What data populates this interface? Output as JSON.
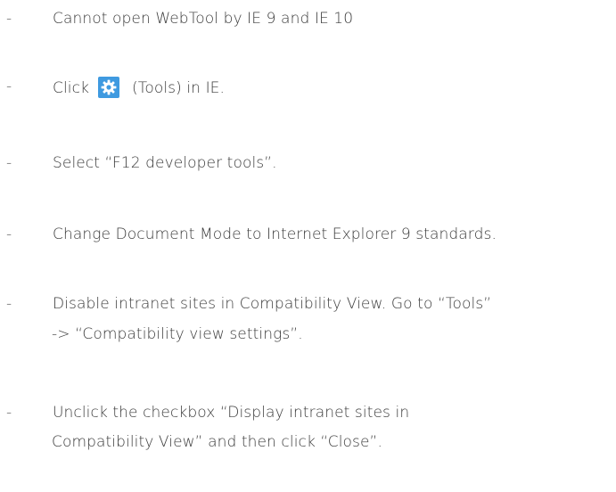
{
  "items": [
    {
      "bullet": "-",
      "lines": [
        "Cannot open WebTool by IE 9 and IE 10"
      ]
    },
    {
      "bullet": "-",
      "before_icon": "Click",
      "icon": "gear-icon",
      "after_icon": "(Tools) in IE."
    },
    {
      "bullet": "-",
      "lines": [
        "Select “F12 developer tools”."
      ]
    },
    {
      "bullet": "-",
      "lines": [
        "Change Document Mode to Internet Explorer 9 standards."
      ]
    },
    {
      "bullet": "-",
      "lines": [
        "Disable intranet sites in Compatibility View. Go to “Tools”",
        "-> “Compatibility view settings”."
      ]
    },
    {
      "bullet": "-",
      "lines": [
        "Unclick the checkbox “Display intranet sites in",
        "Compatibility View” and then click “Close”."
      ]
    }
  ],
  "colors": {
    "text": "#3a3a3a",
    "icon_background": "#3f9ae0",
    "icon_foreground": "#ffffff"
  }
}
